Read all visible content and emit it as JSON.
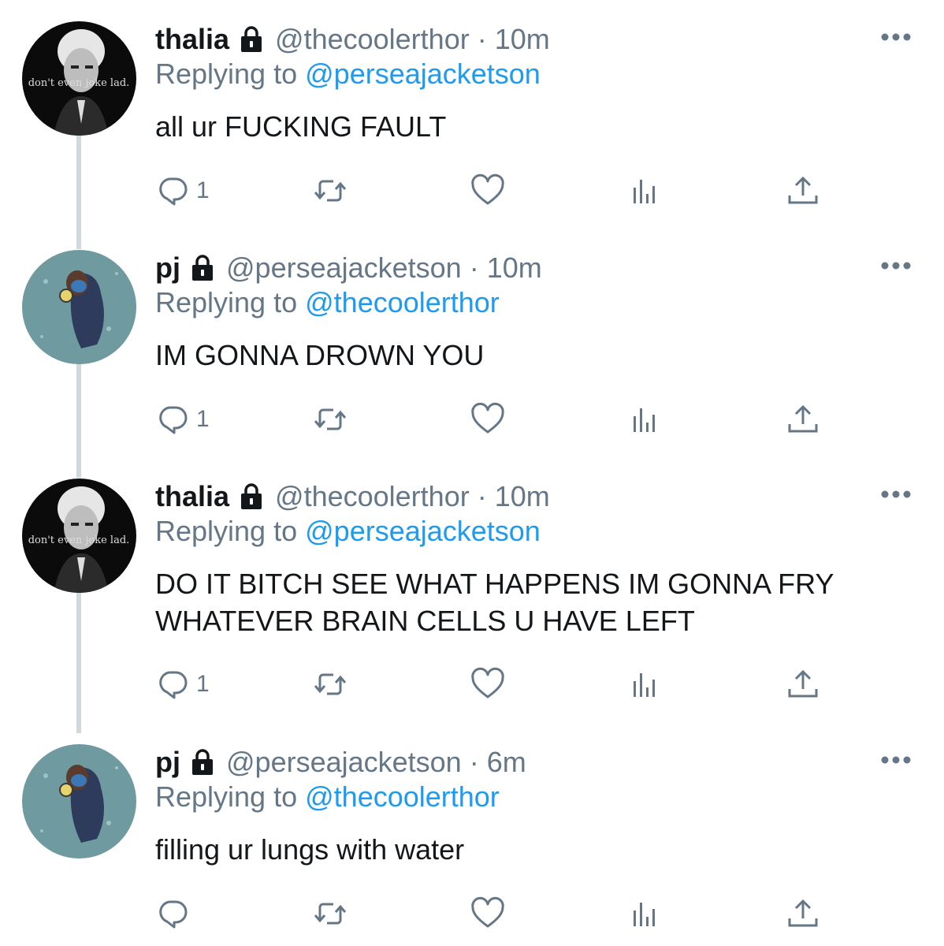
{
  "tweets": [
    {
      "name": "thalia",
      "handle": "@thecoolerthor",
      "separator": "·",
      "time": "10m",
      "reply_prefix": "Replying to",
      "reply_to": "@perseajacketson",
      "text": "all ur FUCKING FAULT",
      "reply_count": "1",
      "avatar_caption": "don't even joke lad."
    },
    {
      "name": "pj",
      "handle": "@perseajacketson",
      "separator": "·",
      "time": "10m",
      "reply_prefix": "Replying to",
      "reply_to": "@thecoolerthor",
      "text": "IM GONNA DROWN YOU",
      "reply_count": "1"
    },
    {
      "name": "thalia",
      "handle": "@thecoolerthor",
      "separator": "·",
      "time": "10m",
      "reply_prefix": "Replying to",
      "reply_to": "@perseajacketson",
      "text": "DO IT BITCH SEE WHAT HAPPENS IM GONNA FRY WHATEVER BRAIN CELLS U HAVE LEFT",
      "reply_count": "1",
      "avatar_caption": "don't even joke lad."
    },
    {
      "name": "pj",
      "handle": "@perseajacketson",
      "separator": "·",
      "time": "6m",
      "reply_prefix": "Replying to",
      "reply_to": "@thecoolerthor",
      "text": "filling ur lungs with water",
      "reply_count": ""
    }
  ],
  "colors": {
    "text": "#14171a",
    "secondary": "#657786",
    "link": "#1d9bf0",
    "thread_line": "#cfd9de"
  },
  "icons": {
    "lock": "lock-icon",
    "more": "more-icon",
    "reply": "reply-icon",
    "retweet": "retweet-icon",
    "like": "like-icon",
    "stats": "stats-icon",
    "share": "share-icon"
  }
}
